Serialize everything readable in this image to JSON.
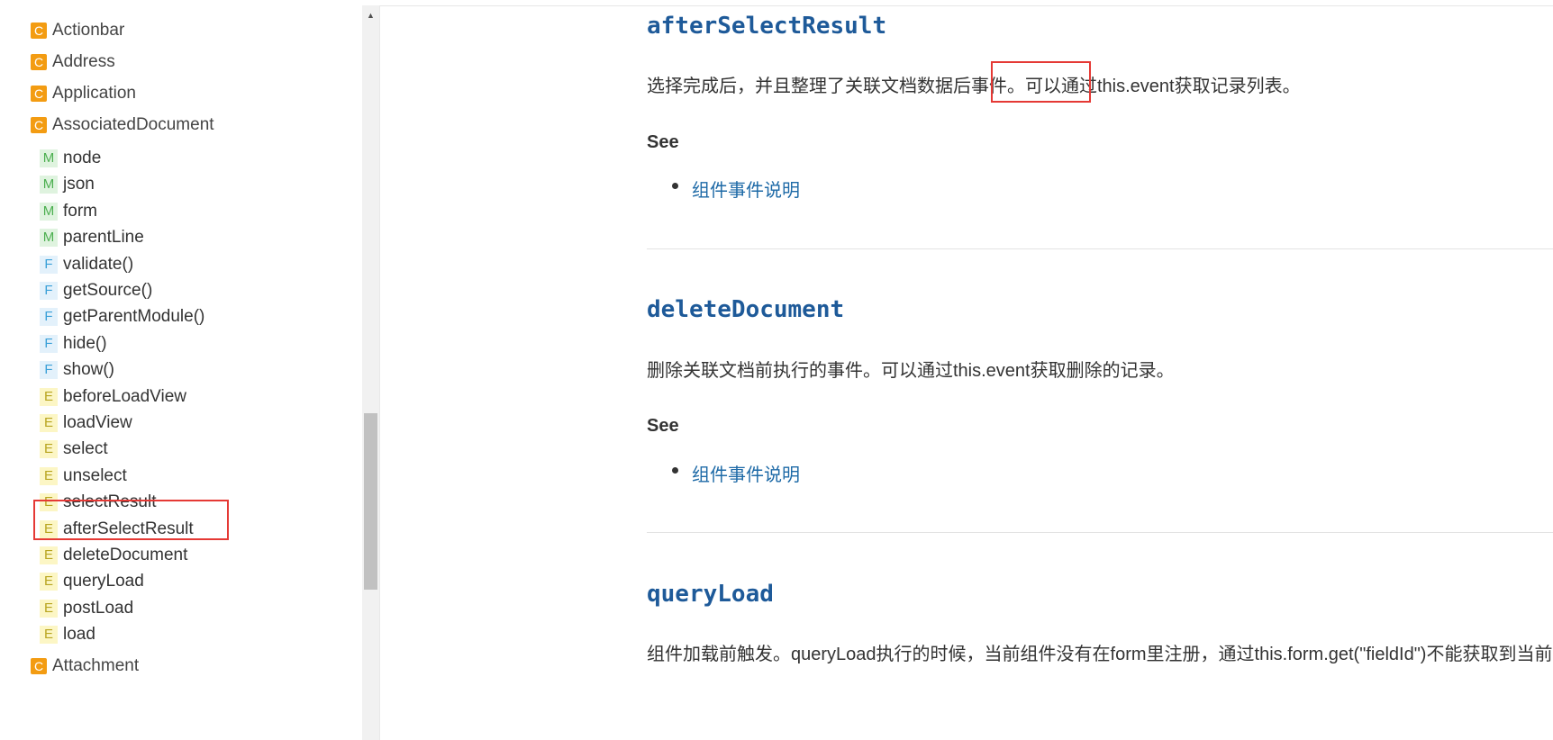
{
  "sidebar": {
    "items": [
      {
        "badge": "C",
        "kind": "c",
        "label": "Actionbar"
      },
      {
        "badge": "C",
        "kind": "c",
        "label": "Address"
      },
      {
        "badge": "C",
        "kind": "c",
        "label": "Application"
      },
      {
        "badge": "C",
        "kind": "c",
        "label": "AssociatedDocument"
      },
      {
        "badge": "M",
        "kind": "m",
        "label": "node"
      },
      {
        "badge": "M",
        "kind": "m",
        "label": "json"
      },
      {
        "badge": "M",
        "kind": "m",
        "label": "form"
      },
      {
        "badge": "M",
        "kind": "m",
        "label": "parentLine"
      },
      {
        "badge": "F",
        "kind": "f",
        "label": "validate()"
      },
      {
        "badge": "F",
        "kind": "f",
        "label": "getSource()"
      },
      {
        "badge": "F",
        "kind": "f",
        "label": "getParentModule()"
      },
      {
        "badge": "F",
        "kind": "f",
        "label": "hide()"
      },
      {
        "badge": "F",
        "kind": "f",
        "label": "show()"
      },
      {
        "badge": "E",
        "kind": "e",
        "label": "beforeLoadView"
      },
      {
        "badge": "E",
        "kind": "e",
        "label": "loadView"
      },
      {
        "badge": "E",
        "kind": "e",
        "label": "select"
      },
      {
        "badge": "E",
        "kind": "e",
        "label": "unselect"
      },
      {
        "badge": "E",
        "kind": "e",
        "label": "selectResult"
      },
      {
        "badge": "E",
        "kind": "e",
        "label": "afterSelectResult"
      },
      {
        "badge": "E",
        "kind": "e",
        "label": "deleteDocument"
      },
      {
        "badge": "E",
        "kind": "e",
        "label": "queryLoad"
      },
      {
        "badge": "E",
        "kind": "e",
        "label": "postLoad"
      },
      {
        "badge": "E",
        "kind": "e",
        "label": "load"
      },
      {
        "badge": "C",
        "kind": "c",
        "label": "Attachment"
      }
    ]
  },
  "sections": [
    {
      "title": "afterSelectResult",
      "desc_pre": "选择完成后，并且整理了关联文档数据后事件。可以通过",
      "desc_hl": "this.event",
      "desc_post": "获取记录列表。",
      "see": "See",
      "link": "组件事件说明"
    },
    {
      "title": "deleteDocument",
      "desc": "删除关联文档前执行的事件。可以通过this.event获取删除的记录。",
      "see": "See",
      "link": "组件事件说明"
    },
    {
      "title": "queryLoad",
      "desc": "组件加载前触发。queryLoad执行的时候，当前组件没有在form里注册，通过this.form.get(\"fieldId\")不能获取到当前组件，需要用this.target获取当前组件。"
    }
  ],
  "colors": {
    "accent": "#1e5a99",
    "link": "#1e6aa7",
    "highlight": "#e53935"
  }
}
